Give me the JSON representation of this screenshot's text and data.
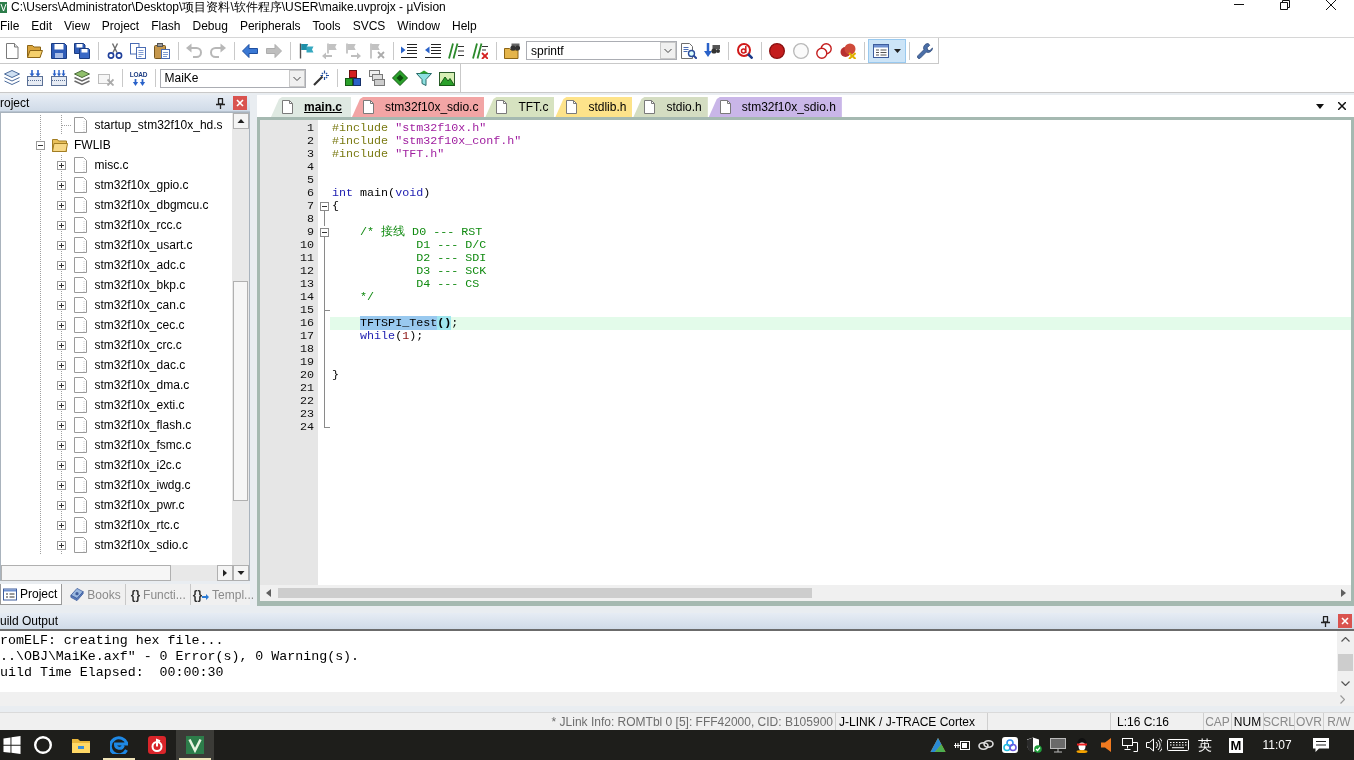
{
  "window": {
    "title": "C:\\Users\\Administrator\\Desktop\\项目资料\\软件程序\\USER\\maike.uvprojx - µVision"
  },
  "menu": [
    "File",
    "Edit",
    "View",
    "Project",
    "Flash",
    "Debug",
    "Peripherals",
    "Tools",
    "SVCS",
    "Window",
    "Help"
  ],
  "toolbar_1": [
    {
      "items": [
        {
          "kind": "new",
          "disabled": false,
          "pressed": false
        },
        {
          "kind": "open",
          "disabled": false,
          "pressed": false
        },
        {
          "kind": "save",
          "disabled": false,
          "pressed": false
        },
        {
          "kind": "save_all",
          "disabled": false,
          "pressed": false
        }
      ]
    },
    {
      "items": [
        {
          "kind": "cut",
          "disabled": false,
          "pressed": false
        },
        {
          "kind": "copy",
          "disabled": false,
          "pressed": false
        },
        {
          "kind": "paste",
          "disabled": false,
          "pressed": false
        }
      ]
    },
    {
      "items": [
        {
          "kind": "undo",
          "disabled": true,
          "pressed": false
        },
        {
          "kind": "redo",
          "disabled": true,
          "pressed": false
        }
      ]
    },
    {
      "items": [
        {
          "kind": "back",
          "disabled": false,
          "pressed": false
        },
        {
          "kind": "forward",
          "disabled": true,
          "pressed": false
        }
      ]
    },
    {
      "items": [
        {
          "kind": "bookmark",
          "disabled": false,
          "pressed": false
        },
        {
          "kind": "bookmark_prev",
          "disabled": true,
          "pressed": false
        },
        {
          "kind": "bookmark_next",
          "disabled": true,
          "pressed": false
        },
        {
          "kind": "bookmark_clear",
          "disabled": true,
          "pressed": false
        }
      ]
    },
    {
      "items": [
        {
          "kind": "indent",
          "disabled": false,
          "pressed": false
        },
        {
          "kind": "unindent",
          "disabled": false,
          "pressed": false
        },
        {
          "kind": "comment",
          "disabled": false,
          "pressed": false
        },
        {
          "kind": "uncomment",
          "disabled": false,
          "pressed": false
        }
      ]
    },
    {
      "items": [
        {
          "kind": "find_files",
          "disabled": false,
          "pressed": false
        },
        {
          "kind": "combo",
          "value": "sprintf",
          "disabled": false,
          "pressed": false
        },
        {
          "kind": "find",
          "disabled": false,
          "pressed": false
        },
        {
          "kind": "find_next",
          "disabled": false,
          "pressed": false
        }
      ]
    },
    {
      "items": [
        {
          "kind": "debug",
          "disabled": false,
          "pressed": false
        }
      ]
    },
    {
      "items": [
        {
          "kind": "breakpoint",
          "disabled": false,
          "pressed": false
        },
        {
          "kind": "breakpoint_off",
          "disabled": false,
          "pressed": false
        },
        {
          "kind": "breakpoints_toggle",
          "disabled": false,
          "pressed": false
        },
        {
          "kind": "breakpoints_kill",
          "disabled": false,
          "pressed": false
        }
      ]
    },
    {
      "items": [
        {
          "kind": "window_menu",
          "disabled": false,
          "pressed": true
        }
      ]
    },
    {
      "items": [
        {
          "kind": "config",
          "disabled": false,
          "pressed": false
        }
      ]
    }
  ],
  "toolbar_2": [
    {
      "items": [
        {
          "kind": "translate",
          "disabled": false,
          "pressed": false
        },
        {
          "kind": "build",
          "disabled": false,
          "pressed": false
        },
        {
          "kind": "rebuild",
          "disabled": false,
          "pressed": false
        },
        {
          "kind": "batch",
          "disabled": false,
          "pressed": false
        },
        {
          "kind": "stop",
          "disabled": true,
          "pressed": false
        }
      ]
    },
    {
      "items": [
        {
          "kind": "load",
          "label": "LOAD",
          "disabled": false,
          "pressed": false
        }
      ]
    },
    {
      "items": [
        {
          "kind": "combo",
          "value": "MaiKe",
          "disabled": false,
          "pressed": false
        },
        {
          "kind": "target_options",
          "disabled": false,
          "pressed": false
        }
      ]
    },
    {
      "items": [
        {
          "kind": "manage",
          "disabled": false,
          "pressed": false
        },
        {
          "kind": "windows",
          "disabled": false,
          "pressed": false
        },
        {
          "kind": "diamond",
          "disabled": false,
          "pressed": false
        },
        {
          "kind": "funnel",
          "disabled": false,
          "pressed": false
        },
        {
          "kind": "packs",
          "disabled": false,
          "pressed": false
        }
      ]
    }
  ],
  "project_panel": {
    "title": "roject",
    "tree": [
      {
        "expanded": true,
        "children": [
          {
            "label": "startup_stm32f10x_hd.s",
            "kind": "file"
          }
        ]
      },
      {
        "label": "FWLIB",
        "kind": "folder",
        "expanded": true,
        "children": [
          {
            "label": "misc.c",
            "kind": "file",
            "expanded": false
          },
          {
            "label": "stm32f10x_gpio.c",
            "kind": "file",
            "expanded": false
          },
          {
            "label": "stm32f10x_dbgmcu.c",
            "kind": "file",
            "expanded": false
          },
          {
            "label": "stm32f10x_rcc.c",
            "kind": "file",
            "expanded": false
          },
          {
            "label": "stm32f10x_usart.c",
            "kind": "file",
            "expanded": false
          },
          {
            "label": "stm32f10x_adc.c",
            "kind": "file",
            "expanded": false
          },
          {
            "label": "stm32f10x_bkp.c",
            "kind": "file",
            "expanded": false
          },
          {
            "label": "stm32f10x_can.c",
            "kind": "file",
            "expanded": false
          },
          {
            "label": "stm32f10x_cec.c",
            "kind": "file",
            "expanded": false
          },
          {
            "label": "stm32f10x_crc.c",
            "kind": "file",
            "expanded": false
          },
          {
            "label": "stm32f10x_dac.c",
            "kind": "file",
            "expanded": false
          },
          {
            "label": "stm32f10x_dma.c",
            "kind": "file",
            "expanded": false
          },
          {
            "label": "stm32f10x_exti.c",
            "kind": "file",
            "expanded": false
          },
          {
            "label": "stm32f10x_flash.c",
            "kind": "file",
            "expanded": false
          },
          {
            "label": "stm32f10x_fsmc.c",
            "kind": "file",
            "expanded": false
          },
          {
            "label": "stm32f10x_i2c.c",
            "kind": "file",
            "expanded": false
          },
          {
            "label": "stm32f10x_iwdg.c",
            "kind": "file",
            "expanded": false
          },
          {
            "label": "stm32f10x_pwr.c",
            "kind": "file",
            "expanded": false
          },
          {
            "label": "stm32f10x_rtc.c",
            "kind": "file",
            "expanded": false
          },
          {
            "label": "stm32f10x_sdio.c",
            "kind": "file",
            "expanded": false
          }
        ]
      }
    ],
    "tabs": [
      {
        "kind": "project",
        "label": "Project",
        "selected": true
      },
      {
        "kind": "books",
        "label": "Books",
        "selected": false
      },
      {
        "kind": "functions",
        "glyph": "{}",
        "label": "Functi...",
        "selected": false
      },
      {
        "kind": "templates",
        "glyph": "{}",
        "label": "Templ...",
        "selected": false
      }
    ]
  },
  "editor": {
    "tabs": [
      {
        "label": "main.c",
        "color": "#dfe9e2",
        "selected": true
      },
      {
        "label": "stm32f10x_sdio.c",
        "color": "#f2a5a5",
        "selected": false
      },
      {
        "label": "TFT.c",
        "color": "#d6e2c0",
        "selected": false
      },
      {
        "label": "stdlib.h",
        "color": "#fde38a",
        "selected": false
      },
      {
        "label": "stdio.h",
        "color": "#d4ddc2",
        "selected": false
      },
      {
        "label": "stm32f10x_sdio.h",
        "color": "#c9b6e8",
        "selected": false
      }
    ],
    "lines": [
      {
        "number": "1",
        "kind": "plain",
        "current": false,
        "tokens": [
          {
            "kind": "preproc",
            "text": "#include "
          },
          {
            "kind": "string",
            "text": "\"stm32f10x.h\""
          }
        ]
      },
      {
        "number": "2",
        "kind": "plain",
        "current": false,
        "tokens": [
          {
            "kind": "preproc",
            "text": "#include "
          },
          {
            "kind": "string",
            "text": "\"stm32f10x_conf.h\""
          }
        ]
      },
      {
        "number": "3",
        "kind": "plain",
        "current": false,
        "tokens": [
          {
            "kind": "preproc",
            "text": "#include "
          },
          {
            "kind": "string",
            "text": "\"TFT.h\""
          }
        ]
      },
      {
        "number": "4",
        "kind": "plain",
        "current": false
      },
      {
        "number": "5",
        "kind": "plain",
        "current": false
      },
      {
        "number": "6",
        "kind": "plain",
        "current": false,
        "tokens": [
          {
            "kind": "keyword",
            "text": "int"
          },
          {
            "kind": "plain",
            "text": " main("
          },
          {
            "kind": "keyword",
            "text": "void"
          },
          {
            "kind": "plain",
            "text": ")"
          }
        ]
      },
      {
        "number": "7",
        "kind": "fold",
        "current": false,
        "tokens": [
          {
            "kind": "plain",
            "text": "{"
          }
        ]
      },
      {
        "number": "8",
        "kind": "body",
        "current": false
      },
      {
        "number": "9",
        "kind": "fold",
        "current": false,
        "tokens": [
          {
            "kind": "comment",
            "text": "    /* 接线 D0 --- RST"
          }
        ]
      },
      {
        "number": "10",
        "kind": "body",
        "current": false,
        "tokens": [
          {
            "kind": "comment",
            "text": "            D1 --- D/C"
          }
        ]
      },
      {
        "number": "11",
        "kind": "body",
        "current": false,
        "tokens": [
          {
            "kind": "comment",
            "text": "            D2 --- SDI"
          }
        ]
      },
      {
        "number": "12",
        "kind": "body",
        "current": false,
        "tokens": [
          {
            "kind": "comment",
            "text": "            D3 --- SCK"
          }
        ]
      },
      {
        "number": "13",
        "kind": "body",
        "current": false,
        "tokens": [
          {
            "kind": "comment",
            "text": "            D4 --- CS"
          }
        ]
      },
      {
        "number": "14",
        "kind": "body",
        "current": false,
        "tokens": [
          {
            "kind": "comment",
            "text": "    */"
          }
        ]
      },
      {
        "number": "15",
        "kind": "end",
        "current": false
      },
      {
        "number": "16",
        "kind": "body",
        "current": true,
        "tokens": [
          {
            "kind": "selection",
            "text": "    TFTSPI_Test"
          },
          {
            "kind": "brace_match",
            "text": "()"
          },
          {
            "kind": "plain",
            "text": ";"
          }
        ]
      },
      {
        "number": "17",
        "kind": "body",
        "current": false,
        "tokens": [
          {
            "kind": "keyword",
            "text": "    while"
          },
          {
            "kind": "plain",
            "text": "("
          },
          {
            "kind": "number",
            "text": "1"
          },
          {
            "kind": "plain",
            "text": ");"
          }
        ]
      },
      {
        "number": "18",
        "kind": "body",
        "current": false
      },
      {
        "number": "19",
        "kind": "body",
        "current": false
      },
      {
        "number": "20",
        "kind": "body",
        "current": false,
        "tokens": [
          {
            "kind": "plain",
            "text": "}"
          }
        ]
      },
      {
        "number": "21",
        "kind": "body",
        "current": false
      },
      {
        "number": "22",
        "kind": "body",
        "current": false
      },
      {
        "number": "23",
        "kind": "body",
        "current": false
      },
      {
        "number": "24",
        "kind": "last",
        "current": false
      }
    ]
  },
  "build_output": {
    "title": "uild Output",
    "lines": [
      "romELF: creating hex file...",
      "..\\OBJ\\MaiKe.axf\" - 0 Error(s), 0 Warning(s).",
      "uild Time Elapsed:  00:00:30"
    ]
  },
  "status_bar": {
    "message": "* JLink Info: ROMTbl 0 [5]: FFF42000, CID: B105900",
    "debugger": "J-LINK / J-TRACE Cortex",
    "position": "L:16 C:16",
    "keys": [
      {
        "label": "CAP",
        "on": false
      },
      {
        "label": "NUM",
        "on": true
      },
      {
        "label": "SCRL",
        "on": false
      },
      {
        "label": "OVR",
        "on": false
      },
      {
        "label": "R/W",
        "on": false
      }
    ]
  },
  "taskbar": {
    "apps": [
      {
        "kind": "start",
        "running": false,
        "active": false
      },
      {
        "kind": "search",
        "running": false,
        "active": false
      },
      {
        "kind": "explorer",
        "running": false,
        "active": false
      },
      {
        "kind": "browser",
        "running": true,
        "active": false
      },
      {
        "kind": "music",
        "running": false,
        "active": false
      },
      {
        "kind": "ide",
        "running": true,
        "active": true
      }
    ],
    "tray": [
      {
        "kind": "triangle"
      },
      {
        "kind": "power"
      },
      {
        "kind": "link"
      },
      {
        "kind": "cloud"
      },
      {
        "kind": "shield"
      },
      {
        "kind": "monitor"
      },
      {
        "kind": "penguin"
      },
      {
        "kind": "speaker"
      },
      {
        "kind": "network"
      },
      {
        "kind": "volume"
      },
      {
        "kind": "keyboard"
      }
    ],
    "ime": "英",
    "ime_mode": "M",
    "clock": "11:07"
  }
}
